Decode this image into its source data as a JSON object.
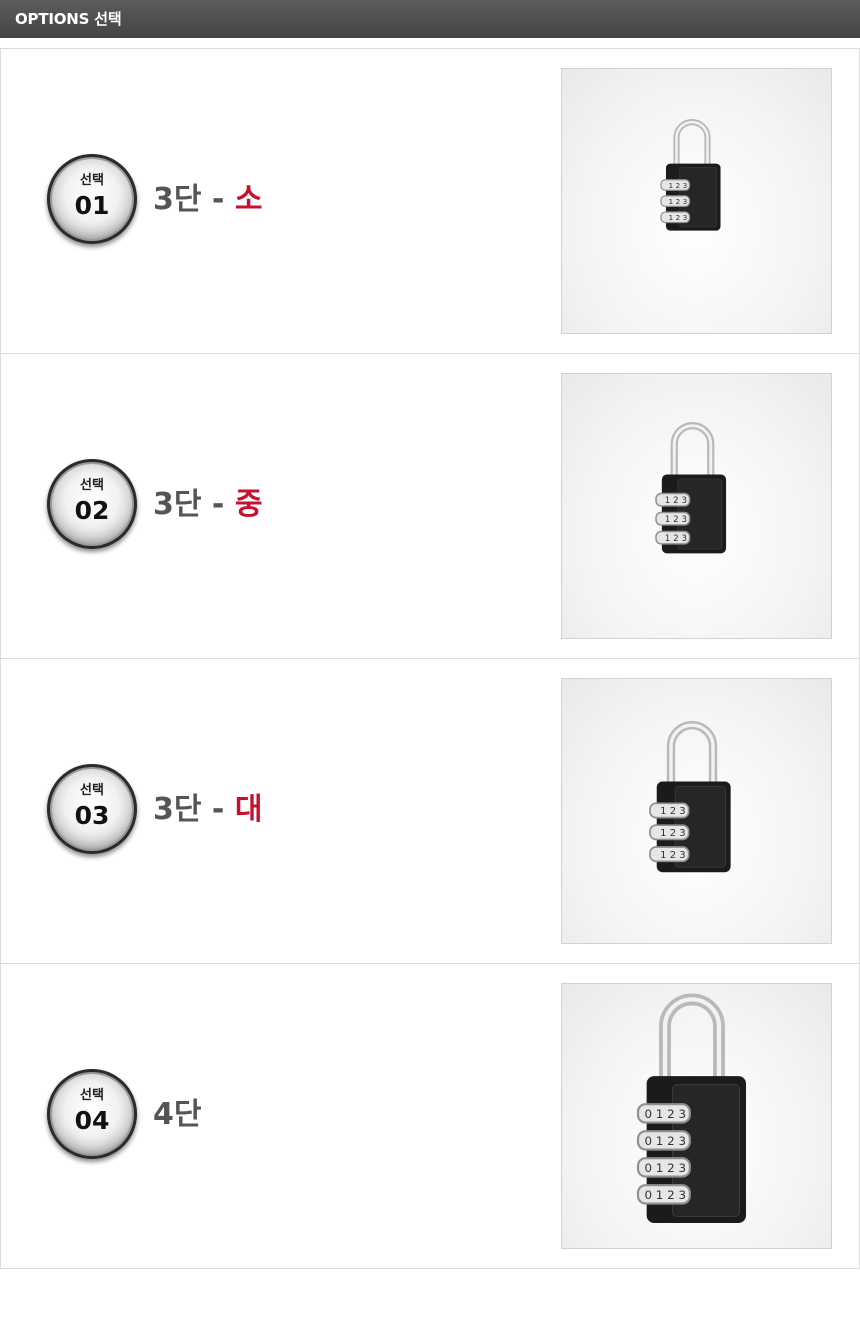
{
  "header": {
    "title": "OPTIONS 선택"
  },
  "options": [
    {
      "badge_label": "선택",
      "badge_number": "01",
      "name": "3단 - ",
      "size": "소",
      "dial_count": 3
    },
    {
      "badge_label": "선택",
      "badge_number": "02",
      "name": "3단 - ",
      "size": "중",
      "dial_count": 3
    },
    {
      "badge_label": "선택",
      "badge_number": "03",
      "name": "3단 - ",
      "size": "대",
      "dial_count": 3
    },
    {
      "badge_label": "선택",
      "badge_number": "04",
      "name": "4단",
      "size": "",
      "dial_count": 4
    }
  ],
  "colors": {
    "accent": "#c8102e",
    "header_bg": "#4d4d4d",
    "title_gray": "#555555"
  }
}
